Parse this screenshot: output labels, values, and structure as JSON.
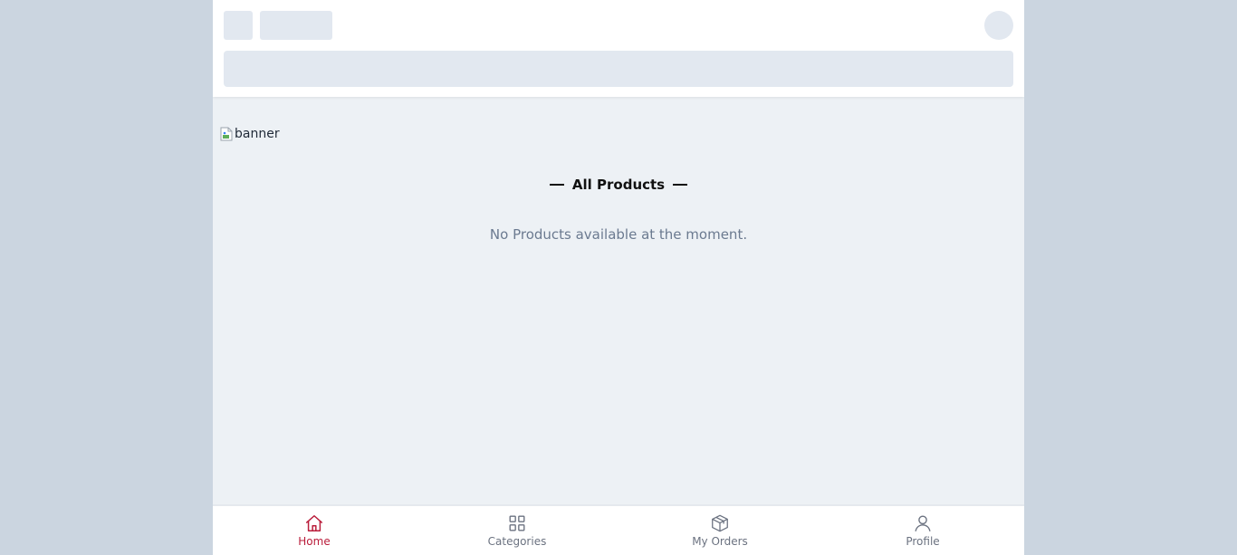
{
  "banner": {
    "alt": "banner"
  },
  "section": {
    "title": "All Products"
  },
  "products": {
    "empty_message": "No Products available at the moment."
  },
  "bottom_nav": {
    "active_color": "#b91c3a",
    "inactive_color": "#6b7280",
    "items": [
      {
        "label": "Home",
        "icon": "home-icon",
        "active": true
      },
      {
        "label": "Categories",
        "icon": "grid-icon",
        "active": false
      },
      {
        "label": "My Orders",
        "icon": "package-icon",
        "active": false
      },
      {
        "label": "Profile",
        "icon": "user-icon",
        "active": false
      }
    ]
  }
}
